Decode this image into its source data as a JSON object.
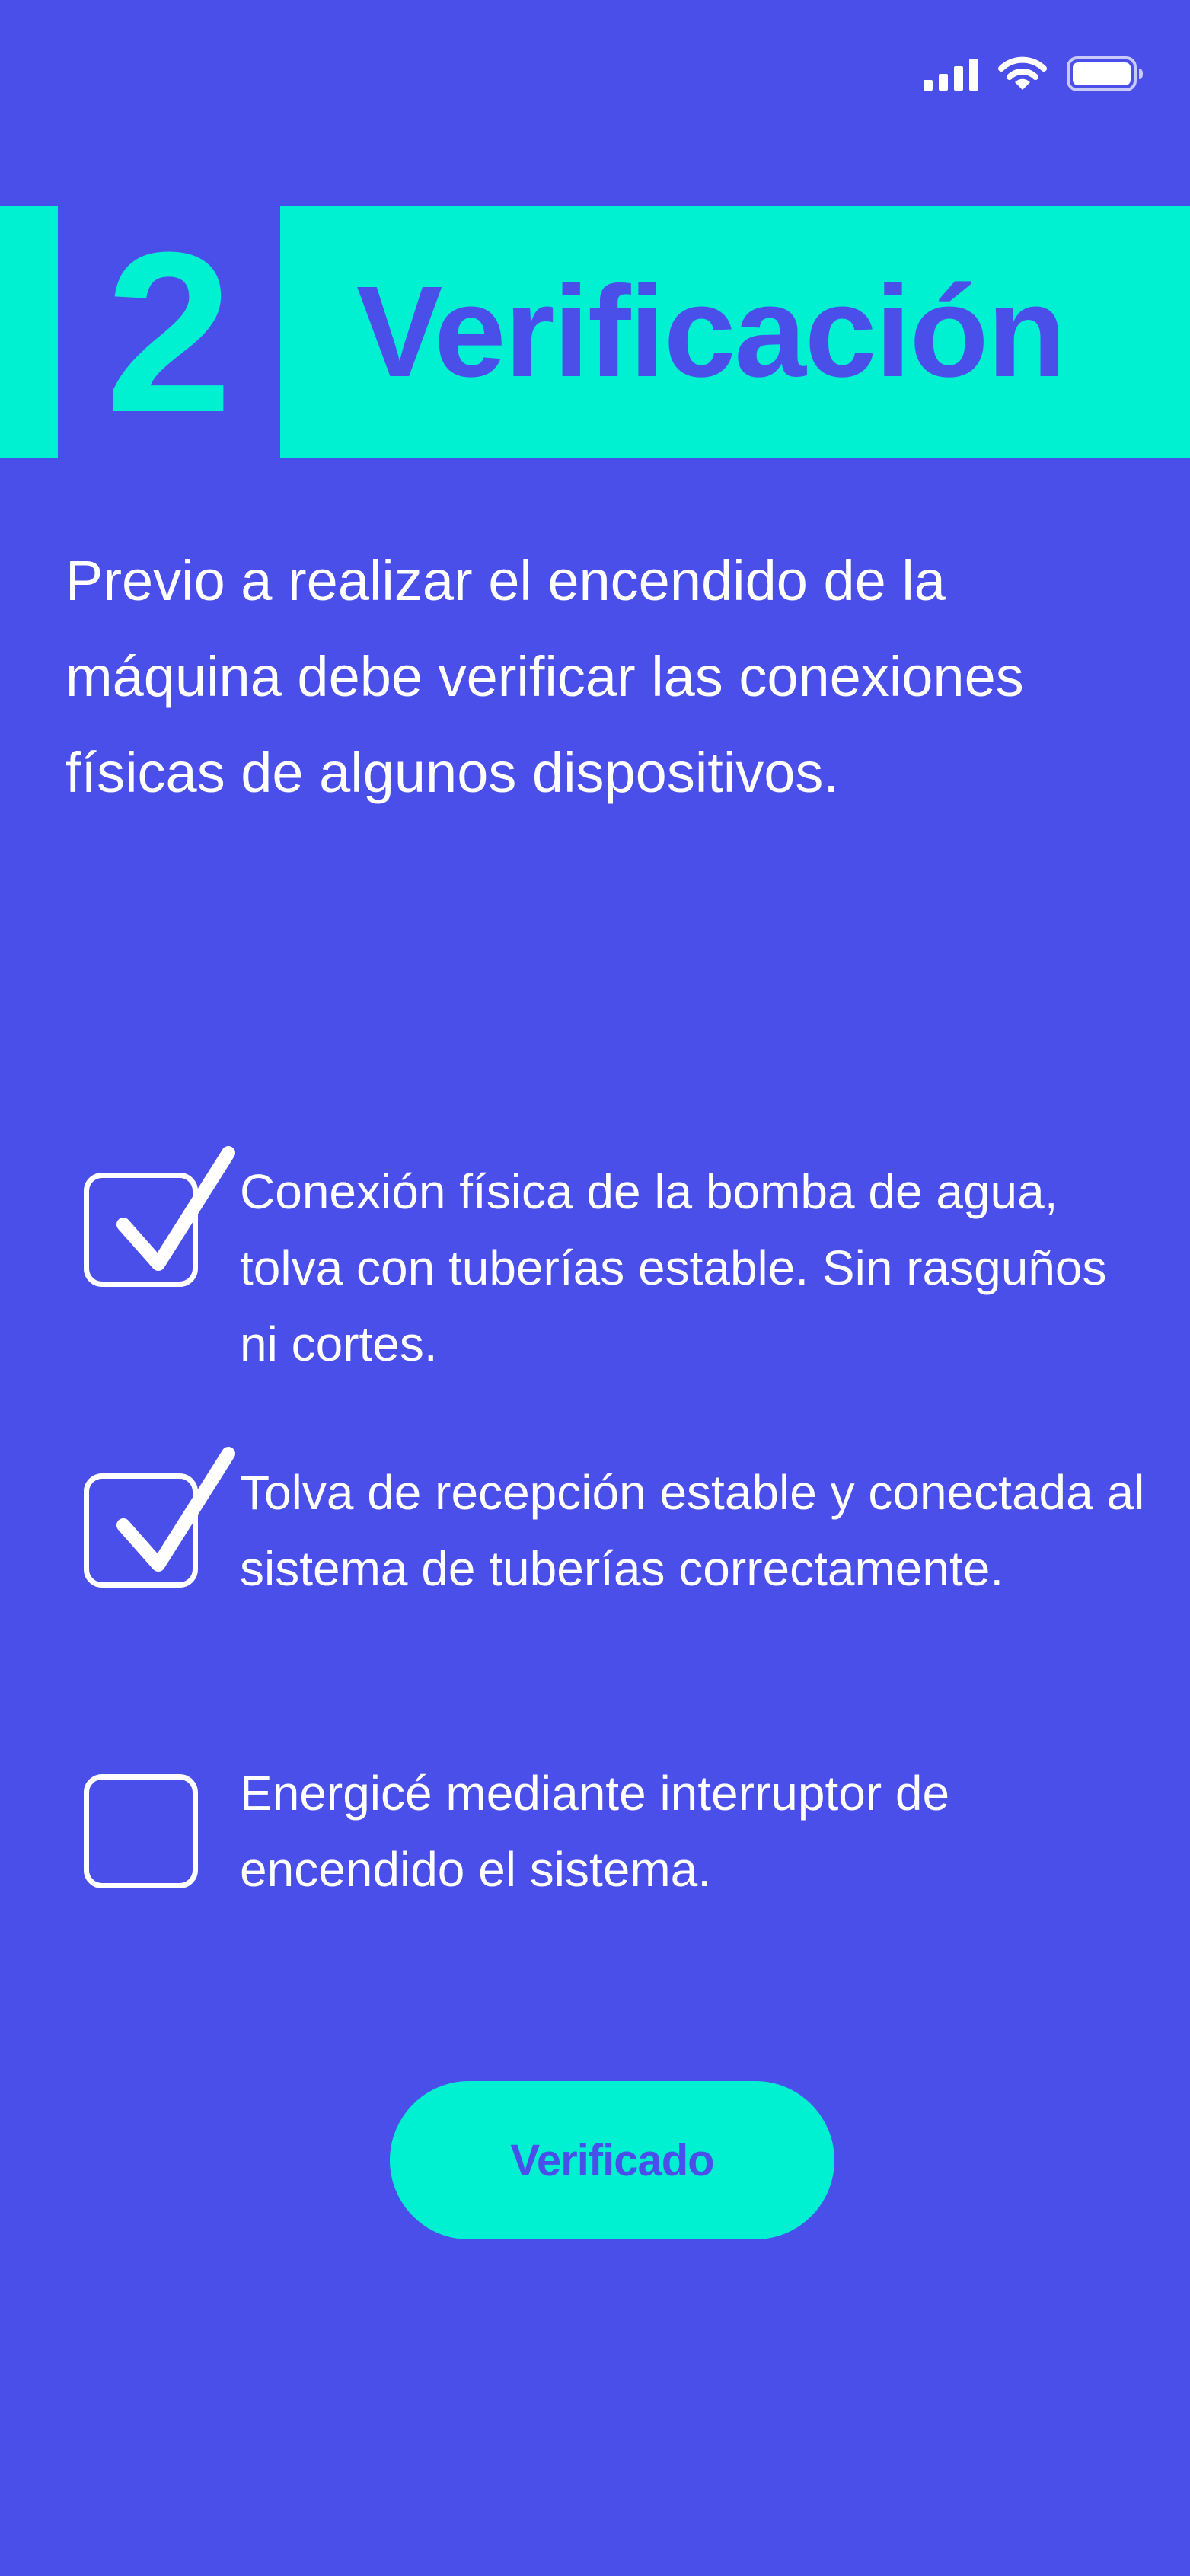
{
  "status_bar": {
    "icons": [
      "cellular-signal-icon",
      "wifi-icon",
      "battery-icon"
    ]
  },
  "header": {
    "step_number": "2",
    "title": "Verificación"
  },
  "intro": {
    "text": "Previo a realizar el encendido de la máquina debe verificar las conexiones físicas de algunos dispositivos."
  },
  "checklist": {
    "items": [
      {
        "label": "Conexión física de la bomba de agua, tolva con tuberías estable. Sin rasguños ni cortes.",
        "checked": true
      },
      {
        "label": "Tolva de recepción estable y conectada al sistema de tuberías correctamente.",
        "checked": true
      },
      {
        "label": "Energicé mediante interruptor de encendido el sistema.",
        "checked": false
      }
    ]
  },
  "actions": {
    "verify_label": "Verificado"
  },
  "colors": {
    "background": "#4a4fea",
    "accent": "#00f0d2",
    "text": "#ffffff"
  }
}
